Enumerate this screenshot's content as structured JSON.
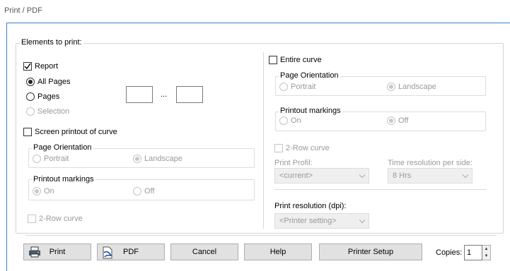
{
  "window": {
    "title": "Print / PDF"
  },
  "elements_group": {
    "legend": "Elements to print:"
  },
  "report": {
    "label": "Report",
    "checked": true,
    "options": {
      "all_pages": "All Pages",
      "pages": "Pages",
      "selection": "Selection"
    },
    "selected": "all_pages",
    "range_separator": "..."
  },
  "screen_printout": {
    "label": "Screen printout of curve",
    "orientation": {
      "legend": "Page Orientation",
      "portrait": "Portrait",
      "landscape": "Landscape",
      "selected": "landscape"
    },
    "markings": {
      "legend": "Printout markings",
      "on": "On",
      "off": "Off",
      "selected": "on"
    },
    "two_row": "2-Row curve"
  },
  "entire_curve": {
    "label": "Entire curve",
    "orientation": {
      "legend": "Page Orientation",
      "portrait": "Portrait",
      "landscape": "Landscape",
      "selected": "landscape"
    },
    "markings": {
      "legend": "Printout markings",
      "on": "On",
      "off": "Off",
      "selected": "off"
    },
    "two_row": "2-Row curve",
    "print_profil": {
      "label": "Print Profil:",
      "value": "<current>"
    },
    "time_resolution": {
      "label": "Time resolution per side:",
      "value": "8 Hrs"
    },
    "print_resolution": {
      "label": "Print resolution (dpi):",
      "value": "<Printer setting>"
    }
  },
  "buttons": {
    "print": "Print",
    "pdf": "PDF",
    "cancel": "Cancel",
    "help": "Help",
    "printer_setup": "Printer Setup"
  },
  "copies": {
    "label": "Copies:",
    "value": "1"
  },
  "colors": {
    "accent": "#3b7fd1",
    "disabled": "#9a9a9a"
  }
}
